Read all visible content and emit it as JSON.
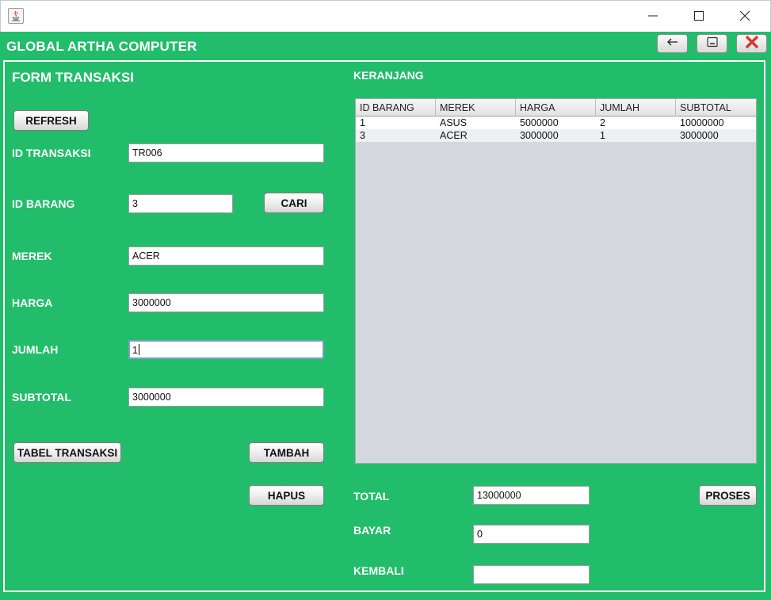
{
  "window": {
    "app_title": "GLOBAL ARTHA COMPUTER"
  },
  "form": {
    "title": "FORM TRANSAKSI",
    "refresh_label": "REFRESH",
    "id_transaksi": {
      "label": "ID TRANSAKSI",
      "value": "TR006"
    },
    "id_barang": {
      "label": "ID BARANG",
      "value": "3"
    },
    "cari_label": "CARI",
    "merek": {
      "label": "MEREK",
      "value": "ACER"
    },
    "harga": {
      "label": "HARGA",
      "value": "3000000"
    },
    "jumlah": {
      "label": "JUMLAH",
      "value": "1"
    },
    "subtotal": {
      "label": "SUBTOTAL",
      "value": "3000000"
    },
    "tabel_transaksi_label": "TABEL TRANSAKSI",
    "tambah_label": "TAMBAH",
    "hapus_label": "HAPUS"
  },
  "cart": {
    "title": "KERANJANG",
    "columns": [
      "ID BARANG",
      "MEREK",
      "HARGA",
      "JUMLAH",
      "SUBTOTAL"
    ],
    "rows": [
      [
        "1",
        "ASUS",
        "5000000",
        "2",
        "10000000"
      ],
      [
        "3",
        "ACER",
        "3000000",
        "1",
        "3000000"
      ]
    ]
  },
  "payment": {
    "total": {
      "label": "TOTAL",
      "value": "13000000"
    },
    "bayar": {
      "label": "BAYAR",
      "value": "0"
    },
    "kembali": {
      "label": "KEMBALI",
      "value": ""
    },
    "proses_label": "PROSES"
  },
  "icons": {
    "title_bar": [
      "java-icon",
      "minimize-icon",
      "maximize-icon",
      "close-icon"
    ],
    "toolbar": [
      "back-arrow-icon",
      "minimize-window-icon",
      "close-x-icon"
    ]
  },
  "colors": {
    "background_green": "#22bd6a",
    "close_red": "#d9362b"
  }
}
